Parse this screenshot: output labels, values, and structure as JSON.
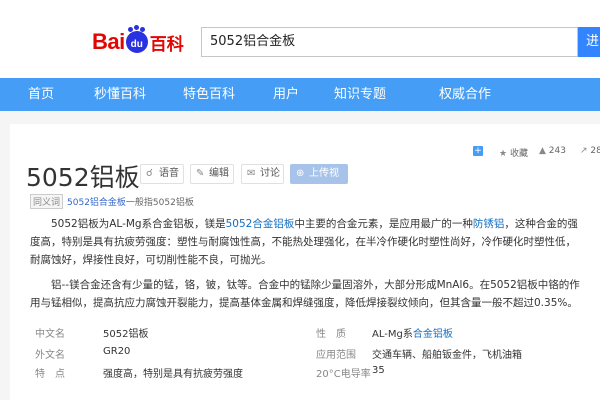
{
  "header": {
    "logo": {
      "bai": "Bai",
      "du": "du",
      "baike": "百科"
    },
    "search_value": "5052铝合金板",
    "search_button": "进"
  },
  "nav": {
    "items": [
      "首页",
      "秒懂百科",
      "特色百科",
      "用户",
      "知识专题",
      "权威合作"
    ]
  },
  "entry": {
    "title": "5052铝板",
    "buttons": {
      "voice": "语音",
      "edit": "编辑",
      "discuss": "讨论",
      "upload_video": "上传视频"
    },
    "stats": {
      "add": "+",
      "collect_label": "收藏",
      "like_count": "243",
      "share_count": "28"
    },
    "polysemy": {
      "tag": "同义词",
      "link": "5052铝合金板",
      "text": "一般指5052铝板"
    },
    "paragraphs": [
      {
        "pre": "5052铝板为AL-Mg系合金铝板，镁是",
        "link1": "5052合金铝板",
        "mid": "中主要的合金元素，是应用最广的一种",
        "link2": "防锈铝",
        "post": "，这种合金的强度高，特别是具有抗疲劳强度：塑性与耐腐蚀性高，不能热处理强化，在半冷作硬化时塑性尚好，冷作硬化时塑性低，耐腐蚀好，焊接性良好，可切削性能不良，可抛光。"
      },
      {
        "text": "铝--镁合金还含有少量的锰，铬，铍，钛等。合金中的锰除少量固溶外，大部分形成MnAl6。在5052铝板中铬的作用与锰相似，提高抗应力腐蚀开裂能力，提高基体金属和焊缝强度，降低焊接裂纹倾向，但其含量一般不超过0.35%。"
      }
    ],
    "basic_info": {
      "rows": [
        {
          "l1": "中文名",
          "v1": "5052铝板",
          "l2": "性　质",
          "v2_pre": "AL-Mg系",
          "v2_link": "合金铝板"
        },
        {
          "l1": "外文名",
          "v1": "GR20",
          "l2": "应用范围",
          "v2": "交通车辆、船舶钣金件，飞机油箱"
        },
        {
          "l1": "特　点",
          "v1": "强度高，特别是具有抗疲劳强度",
          "l2": "20°C电导率",
          "v2": "35"
        }
      ]
    }
  },
  "colors": {
    "brand_red": "#e10602",
    "brand_blue": "#2932e1",
    "nav_bg": "#459df5",
    "link": "#136ec2",
    "search_button": "#3385ff"
  },
  "icons": {
    "voice": "headphones-icon",
    "edit": "pencil-icon",
    "discuss": "chat-bubble-icon",
    "upload_video": "plus-circle-icon",
    "collect": "star-icon",
    "like": "thumbs-up-icon",
    "share": "share-icon"
  }
}
